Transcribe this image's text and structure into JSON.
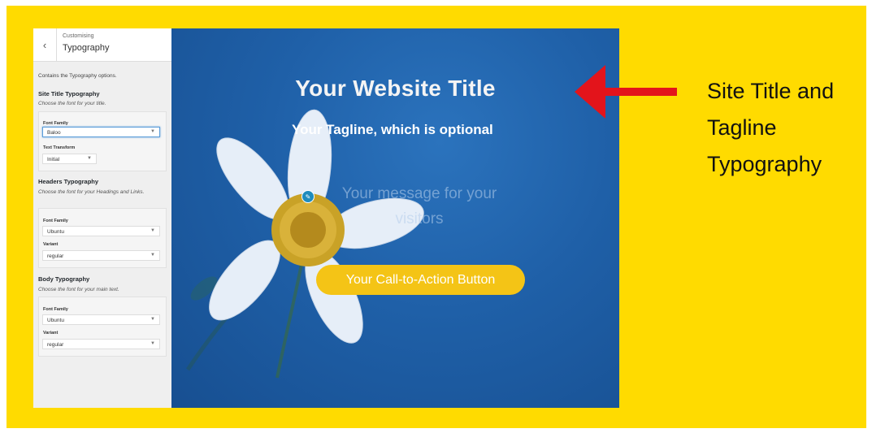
{
  "sidebar": {
    "back_icon": "chevron-left-icon",
    "breadcrumb": "Customising",
    "title": "Typography",
    "description": "Contains the Typography options.",
    "site_title": {
      "heading": "Site Title Typography",
      "subtitle": "Choose the font for your title.",
      "font_family_label": "Font Family",
      "font_family_value": "Baloo",
      "text_transform_label": "Text Transform",
      "text_transform_value": "Initial"
    },
    "headers": {
      "heading": "Headers Typography",
      "subtitle": "Choose the font for your Headings and Links.",
      "font_family_label": "Font Family",
      "font_family_value": "Ubuntu",
      "variant_label": "Variant",
      "variant_value": "regular"
    },
    "body": {
      "heading": "Body Typography",
      "subtitle": "Choose the font for your main text.",
      "font_family_label": "Font Family",
      "font_family_value": "Ubuntu",
      "variant_label": "Variant",
      "variant_value": "regular"
    }
  },
  "preview": {
    "site_title": "Your Website Title",
    "tagline": "Your Tagline, which is optional",
    "message": "Your message for your visitors",
    "cta_label": "Your Call-to-Action Button",
    "cta_color": "#F4C416",
    "edit_icon": "pencil-icon"
  },
  "annotation": {
    "text": "Site Title and Tagline Typography",
    "arrow_color": "#E3141B",
    "background_color": "#FFDB00"
  }
}
